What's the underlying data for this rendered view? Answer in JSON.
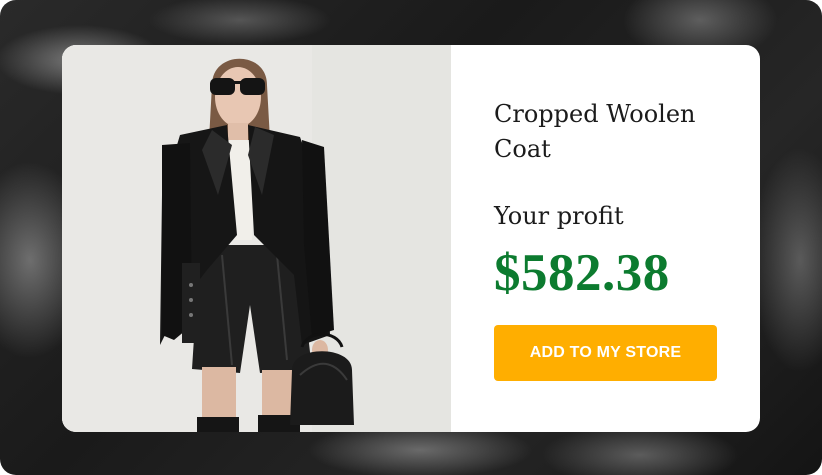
{
  "product": {
    "title": "Cropped Woolen Coat",
    "image_subject": "model-wearing-cropped-black-woolen-coat"
  },
  "profit": {
    "label": "Your profit",
    "value": "$582.38"
  },
  "actions": {
    "add_to_store_label": "ADD TO MY STORE"
  },
  "colors": {
    "profit_green": "#0c7b2f",
    "button_orange": "#ffae00",
    "card_background": "#ffffff"
  }
}
